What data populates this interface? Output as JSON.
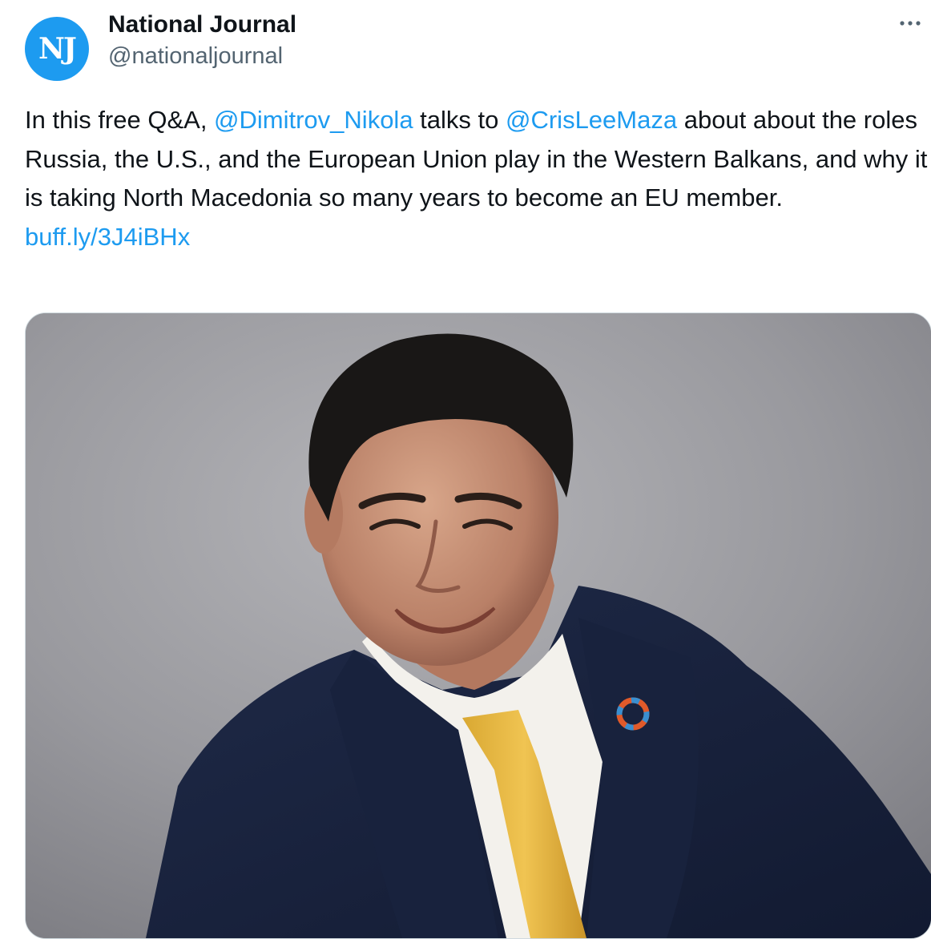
{
  "account": {
    "avatar_text": "NJ",
    "display_name": "National Journal",
    "handle": "@nationaljournal"
  },
  "menu": {
    "more_icon": "more-horizontal-icon"
  },
  "tweet": {
    "text_before": "In this free Q&A, ",
    "mention_1": "@Dimitrov_Nikola",
    "text_middle": " talks to ",
    "mention_2": "@CrisLeeMaza",
    "text_after": " about about the roles Russia, the U.S., and the European Union play in the Western Balkans, and why it is taking North Macedonia so many years to become an EU member.",
    "link": "buff.ly/3J4iBHx"
  },
  "media": {
    "type": "photo"
  },
  "colors": {
    "accent": "#1d9bf0",
    "text": "#0f1419",
    "secondary_text": "#536471",
    "border": "#cfd9de"
  }
}
